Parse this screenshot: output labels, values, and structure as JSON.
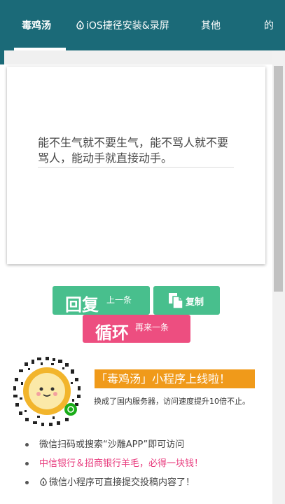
{
  "tabs": [
    {
      "label": "毒鸡汤"
    },
    {
      "label": "iOS捷径安装&录屏"
    },
    {
      "label": "其他"
    },
    {
      "label": "的"
    }
  ],
  "quote": {
    "text": "能不生气就不要生气，能不骂人就不要骂人，能动手就直接动手。"
  },
  "buttons": {
    "reply_big": "回复",
    "reply_small": "上一条",
    "copy_label": "复制",
    "loop_big": "循环",
    "loop_small": "再来一条"
  },
  "promo": {
    "title": "「毒鸡汤」小程序上线啦！",
    "subtitle": "换成了国内服务器，访问速度提升10倍不止。"
  },
  "bullets": [
    {
      "text": "微信扫码或搜索“沙雕APP”即可访问"
    },
    {
      "text": "中信银行＆招商银行羊毛，必得一块钱！"
    },
    {
      "text": "微信小程序可直接提交投稿内容了！"
    }
  ],
  "colors": {
    "topbar": "#1b6a78",
    "green_button": "#48bf8d",
    "pink_button": "#ed4e80",
    "promo_orange": "#f09a1a",
    "pink_text": "#e83c7e"
  }
}
